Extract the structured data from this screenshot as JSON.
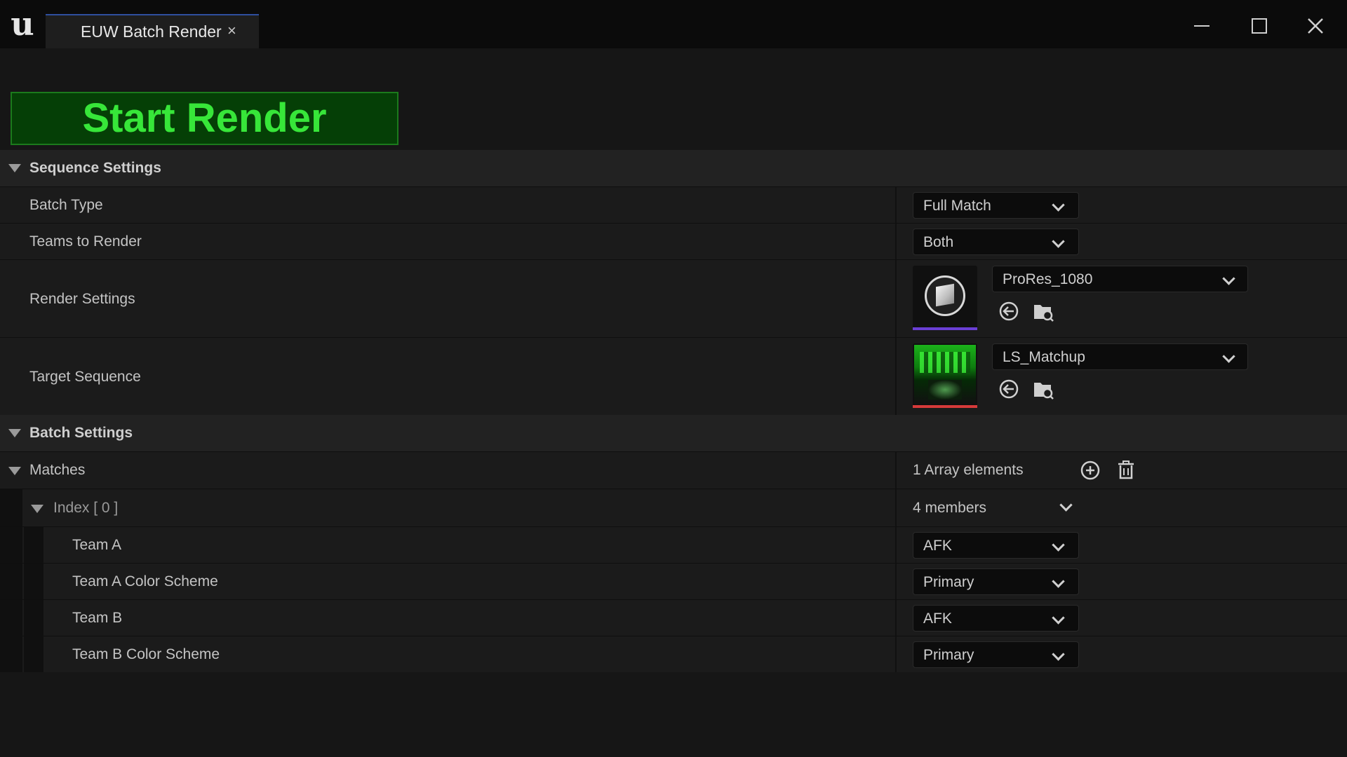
{
  "window": {
    "tab_title": "EUW Batch Render",
    "tab_close": "×"
  },
  "start_button": {
    "label": "Start Render",
    "color": "#37e639"
  },
  "sections": {
    "sequence": {
      "title": "Sequence Settings",
      "batch_type": {
        "label": "Batch Type",
        "value": "Full Match"
      },
      "teams_to_render": {
        "label": "Teams to Render",
        "value": "Both"
      },
      "render_settings": {
        "label": "Render Settings",
        "value": "ProRes_1080",
        "accent": "#6b3fd6"
      },
      "target_sequence": {
        "label": "Target Sequence",
        "value": "LS_Matchup",
        "accent": "#d63a3a"
      }
    },
    "batch": {
      "title": "Batch Settings",
      "matches": {
        "label": "Matches",
        "count": "1 Array elements"
      },
      "index": {
        "label": "Index [ 0 ]",
        "members": "4 members"
      },
      "team_a": {
        "label": "Team A",
        "value": "AFK"
      },
      "team_a_color": {
        "label": "Team A Color Scheme",
        "value": "Primary"
      },
      "team_b": {
        "label": "Team B",
        "value": "AFK"
      },
      "team_b_color": {
        "label": "Team B Color Scheme",
        "value": "Primary"
      }
    }
  }
}
